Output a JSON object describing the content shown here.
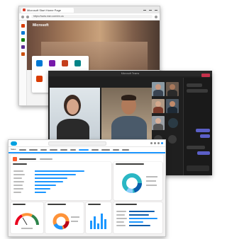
{
  "browser": {
    "tab_title": "Microsoft Start Home Page",
    "address": "https://www.msn.com/en-us",
    "brand_label": "Microsoft"
  },
  "teams": {
    "window_title": "Microsoft Teams"
  },
  "salesforce": {
    "app_name": "Sales"
  },
  "colors": {
    "salesforce_blue": "#1b96ff",
    "teams_dark": "#1f1f1f",
    "leave_red": "#c4314b",
    "donut_teal": "#2bb7c4",
    "bar_blue": "#1b96ff"
  }
}
